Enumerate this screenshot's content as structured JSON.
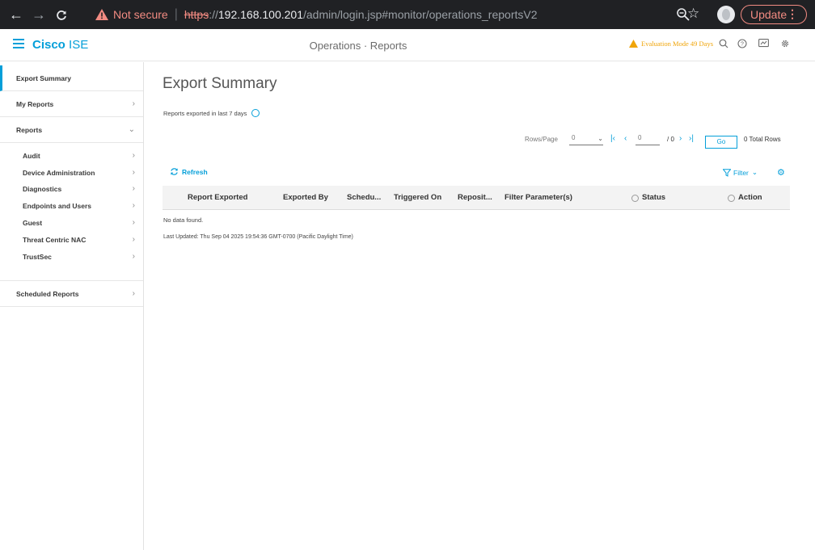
{
  "browser": {
    "not_secure": "Not secure",
    "url_scheme": "https",
    "url_sep": "://",
    "url_host": "192.168.100.201",
    "url_path": "/admin/login.jsp#monitor/operations_reportsV2",
    "update_label": "Update"
  },
  "header": {
    "brand_bold": "Cisco",
    "brand_light": "ISE",
    "title": "Operations · Reports",
    "eval_mode": "Evaluation Mode 49 Days"
  },
  "sidebar": {
    "export_summary": "Export Summary",
    "my_reports": "My Reports",
    "reports": "Reports",
    "sub_items": [
      "Audit",
      "Device Administration",
      "Diagnostics",
      "Endpoints and Users",
      "Guest",
      "Threat Centric NAC",
      "TrustSec"
    ],
    "scheduled_reports": "Scheduled Reports"
  },
  "main": {
    "title": "Export Summary",
    "subtitle": "Reports exported in last 7 days",
    "rows_per_page_label": "Rows/Page",
    "rows_per_page_value": "0",
    "page_value": "0",
    "page_total": "/ 0",
    "go_label": "Go",
    "total_rows": "0 Total Rows",
    "refresh_label": "Refresh",
    "filter_label": "Filter",
    "columns": [
      "Report Exported",
      "Exported By",
      "Schedu...",
      "Triggered On",
      "Reposit...",
      "Filter Parameter(s)",
      "Status",
      "Action"
    ],
    "no_data": "No data found.",
    "last_updated": "Last Updated: Thu Sep 04 2025 19:54:36 GMT-0700 (Pacific Daylight Time)"
  },
  "colors": {
    "accent": "#049fd9",
    "warning": "#f0a50a",
    "chrome_bg": "#202124"
  }
}
